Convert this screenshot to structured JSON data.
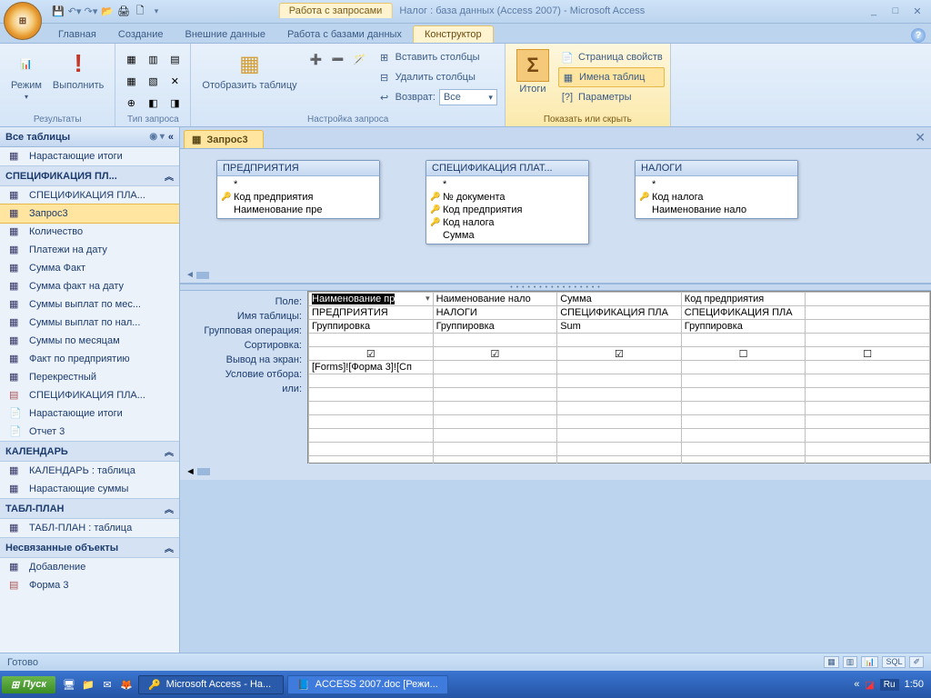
{
  "window": {
    "query_tools": "Работа с запросами",
    "title": "Налог : база данных (Access 2007) - Microsoft Access"
  },
  "ribbon_tabs": [
    "Главная",
    "Создание",
    "Внешние данные",
    "Работа с базами данных",
    "Конструктор"
  ],
  "ribbon": {
    "results": {
      "view": "Режим",
      "run": "Выполнить",
      "label": "Результаты"
    },
    "qtype_label": "Тип запроса",
    "showtable": "Отобразить таблицу",
    "insert_cols": "Вставить столбцы",
    "delete_cols": "Удалить столбцы",
    "return": "Возврат:",
    "return_val": "Все",
    "setup_label": "Настройка запроса",
    "totals": "Итоги",
    "prop": "Страница свойств",
    "tnames": "Имена таблиц",
    "params": "Параметры",
    "show_label": "Показать или скрыть"
  },
  "nav": {
    "head": "Все таблицы",
    "items_top": [
      "Нарастающие итоги"
    ],
    "cat1": "СПЕЦИФИКАЦИЯ ПЛ...",
    "items1": [
      "СПЕЦИФИКАЦИЯ ПЛА...",
      "Запрос3",
      "Количество",
      "Платежи на дату",
      "Сумма Факт",
      "Сумма факт на дату",
      "Суммы выплат по мес...",
      "Суммы выплат по нал...",
      "Суммы по месяцам",
      "Факт по предприятию",
      "Перекрестный",
      "СПЕЦИФИКАЦИЯ ПЛА...",
      "Нарастающие итоги",
      "Отчет 3"
    ],
    "cat2": "КАЛЕНДАРЬ",
    "items2": [
      "КАЛЕНДАРЬ : таблица",
      "Нарастающие суммы"
    ],
    "cat3": "ТАБЛ-ПЛАН",
    "items3": [
      "ТАБЛ-ПЛАН : таблица"
    ],
    "cat4": "Несвязанные объекты",
    "items4": [
      "Добавление",
      "Форма 3"
    ],
    "selected": "Запрос3"
  },
  "doc_tab": "Запрос3",
  "tables": {
    "t1": {
      "name": "ПРЕДПРИЯТИЯ",
      "fields": [
        "*",
        "Код предприятия",
        "Наименование пре"
      ],
      "keys": [
        1
      ]
    },
    "t2": {
      "name": "СПЕЦИФИКАЦИЯ ПЛАТ...",
      "fields": [
        "*",
        "№ документа",
        "Код предприятия",
        "Код налога",
        "Сумма"
      ],
      "keys": [
        1,
        2,
        3
      ]
    },
    "t3": {
      "name": "НАЛОГИ",
      "fields": [
        "*",
        "Код налога",
        "Наименование нало"
      ],
      "keys": [
        1
      ]
    }
  },
  "grid": {
    "row_labels": [
      "Поле:",
      "Имя таблицы:",
      "Групповая операция:",
      "Сортировка:",
      "Вывод на экран:",
      "Условие отбора:",
      "или:"
    ],
    "cols": [
      {
        "field": "Наименование пр",
        "table": "ПРЕДПРИЯТИЯ",
        "op": "Группировка",
        "sort": "",
        "show": true,
        "crit": "[Forms]![Форма 3]![Сп"
      },
      {
        "field": "Наименование нало",
        "table": "НАЛОГИ",
        "op": "Группировка",
        "sort": "",
        "show": true,
        "crit": ""
      },
      {
        "field": "Сумма",
        "table": "СПЕЦИФИКАЦИЯ ПЛА",
        "op": "Sum",
        "sort": "",
        "show": true,
        "crit": ""
      },
      {
        "field": "Код предприятия",
        "table": "СПЕЦИФИКАЦИЯ ПЛА",
        "op": "Группировка",
        "sort": "",
        "show": false,
        "crit": ""
      },
      {
        "field": "",
        "table": "",
        "op": "",
        "sort": "",
        "show": false,
        "crit": ""
      }
    ]
  },
  "status": "Готово",
  "taskbar": {
    "start": "Пуск",
    "app1": "Microsoft Access - На...",
    "app2": "ACCESS 2007.doc [Режи...",
    "lang": "Ru",
    "clock": "1:50"
  }
}
